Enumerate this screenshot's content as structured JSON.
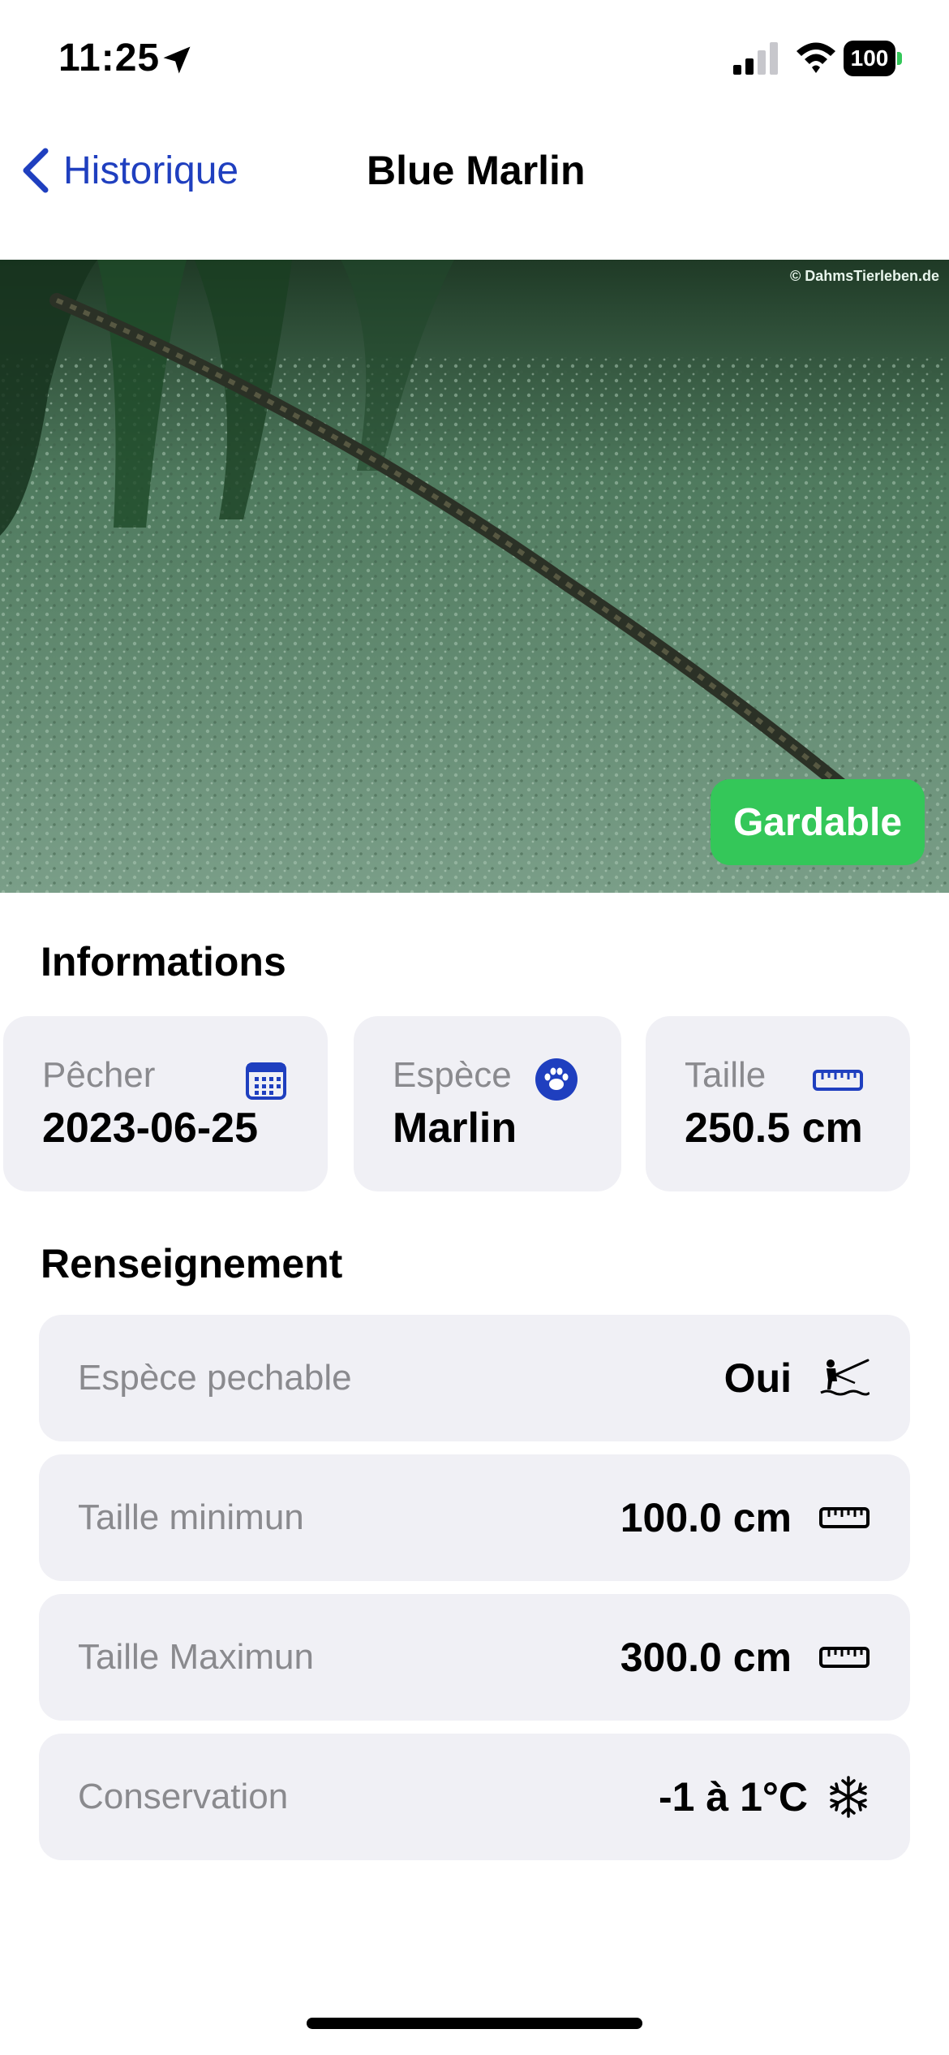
{
  "status_bar": {
    "time": "11:25",
    "battery": "100"
  },
  "nav": {
    "back_label": "Historique",
    "title": "Blue Marlin"
  },
  "hero": {
    "watermark": "© DahmsTierleben.de",
    "badge": "Gardable",
    "badge_color": "#34c759"
  },
  "informations": {
    "title": "Informations",
    "cards": [
      {
        "label": "Pêcher",
        "value": "2023-06-25",
        "icon": "calendar-icon"
      },
      {
        "label": "Espèce",
        "value": "Marlin",
        "icon": "paw-icon"
      },
      {
        "label": "Taille",
        "value": "250.5 cm",
        "icon": "ruler-icon"
      }
    ]
  },
  "renseignement": {
    "title": "Renseignement",
    "rows": [
      {
        "label": "Espèce pechable",
        "value": "Oui",
        "icon": "fishing-icon"
      },
      {
        "label": "Taille minimun",
        "value": "100.0 cm",
        "icon": "ruler-icon"
      },
      {
        "label": "Taille Maximun",
        "value": "300.0 cm",
        "icon": "ruler-icon"
      },
      {
        "label": "Conservation",
        "value": "-1 à 1°C",
        "icon": "snowflake-icon"
      }
    ]
  },
  "colors": {
    "accent": "#1f3fbf",
    "card_bg": "#f0f0f5",
    "label_gray": "#8a8a8e"
  }
}
